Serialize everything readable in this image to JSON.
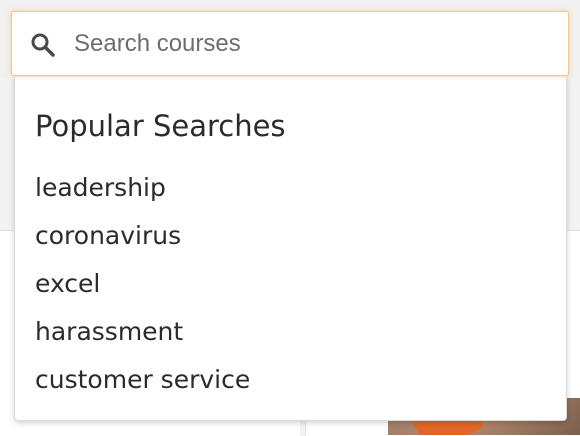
{
  "search": {
    "placeholder": "Search courses",
    "value": "",
    "icon": "search-icon"
  },
  "dropdown": {
    "heading": "Popular Searches",
    "items": [
      "leadership",
      "coronavirus",
      "excel",
      "harassment",
      "customer service"
    ]
  },
  "colors": {
    "focus_border": "#f4c38f",
    "text": "#2b2b2b",
    "placeholder": "#6d6d6d"
  }
}
